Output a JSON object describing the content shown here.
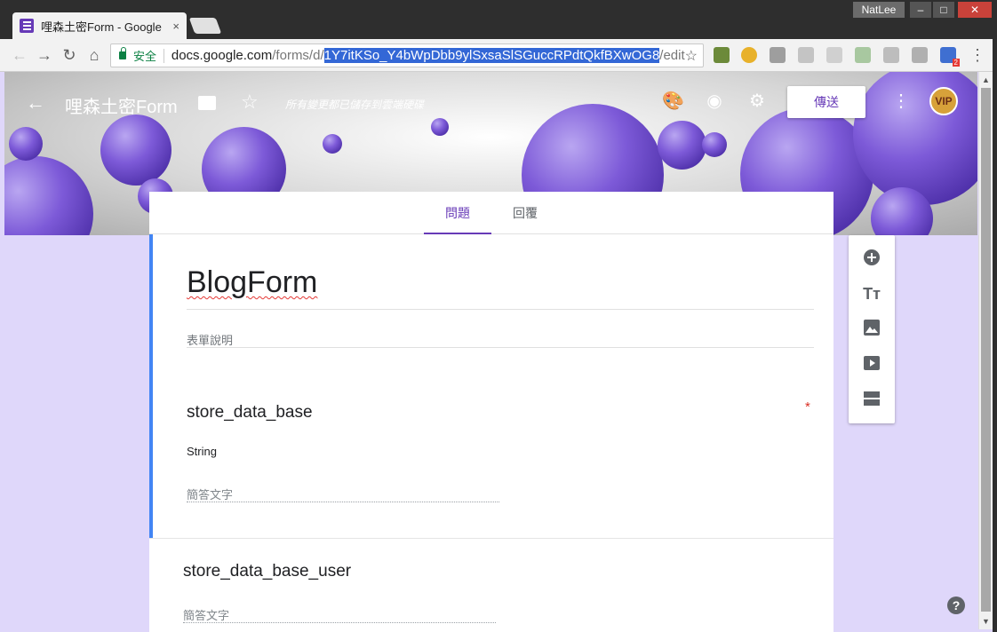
{
  "browser": {
    "tab_title": "哩森土密Form - Google",
    "tab_close": "×",
    "user": "NatLee",
    "secure_label": "安全",
    "url_host": "docs.google.com",
    "url_path": "/forms/d/",
    "url_selected": "1Y7itKSo_Y4bWpDbb9ylSxsaSlSGuccRPdtQkfBXwOG8",
    "url_suffix": "/edit",
    "extension_badge": "2"
  },
  "header": {
    "doc_title": "哩森土密Form",
    "save_status": "所有變更都已儲存到雲端硬碟",
    "send_label": "傳送",
    "avatar_text": "VIP"
  },
  "tabs": [
    {
      "label": "問題",
      "active": true
    },
    {
      "label": "回覆",
      "active": false
    }
  ],
  "form": {
    "title": "BlogForm",
    "description_placeholder": "表單說明",
    "questions": [
      {
        "title": "store_data_base",
        "required": true,
        "required_mark": "*",
        "description": "String",
        "answer_placeholder": "簡答文字"
      },
      {
        "title": "store_data_base_user",
        "required": false,
        "answer_placeholder": "簡答文字"
      }
    ]
  },
  "side_tools": [
    "add-question-icon",
    "title-text-icon",
    "image-icon",
    "video-icon",
    "section-icon"
  ],
  "help_label": "?",
  "colors": {
    "accent": "#673ab7",
    "focus": "#4285f4",
    "page_bg": "#dfd7fa",
    "required": "#d93025"
  }
}
